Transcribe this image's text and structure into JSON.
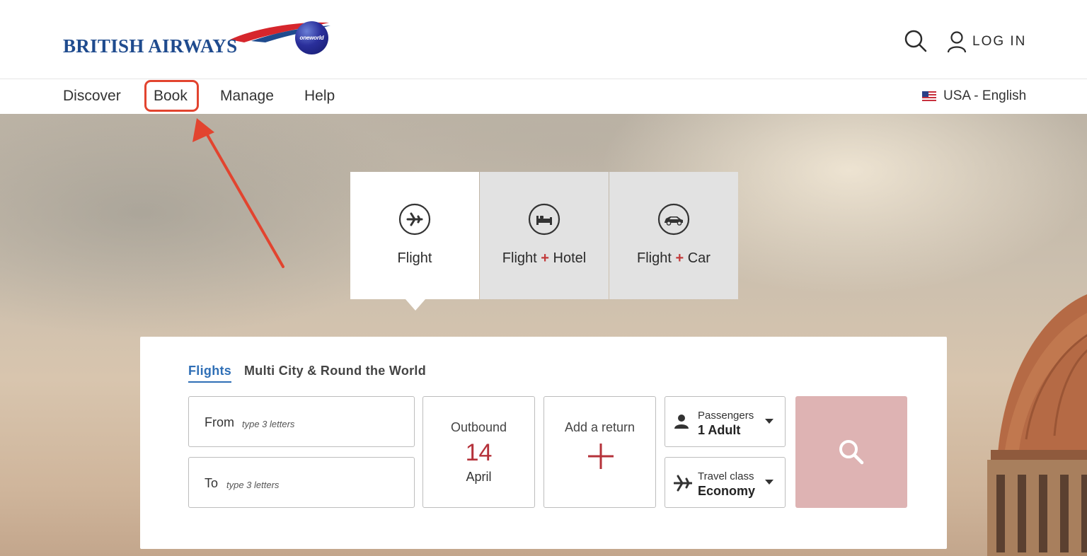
{
  "brand": {
    "name": "BRITISH AIRWAYS",
    "alliance_badge": "oneworld",
    "brand_color": "#1f4b8e",
    "accent_red": "#d6262c"
  },
  "header": {
    "search_icon": "search-icon",
    "login_label": "LOG IN"
  },
  "nav": {
    "items": [
      {
        "label": "Discover"
      },
      {
        "label": "Book"
      },
      {
        "label": "Manage"
      },
      {
        "label": "Help"
      }
    ],
    "locale_label": "USA - English",
    "highlight_color": "#e2442f"
  },
  "product_tabs": [
    {
      "icon": "plane-icon",
      "label": "Flight",
      "active": true
    },
    {
      "icon": "bed-icon",
      "label_a": "Flight",
      "plus": "+",
      "label_b": "Hotel",
      "active": false
    },
    {
      "icon": "car-icon",
      "label_a": "Flight",
      "plus": "+",
      "label_b": "Car",
      "active": false
    }
  ],
  "search_form": {
    "tabs": [
      {
        "label": "Flights",
        "active": true
      },
      {
        "label": "Multi City & Round the World",
        "active": false
      }
    ],
    "from": {
      "label": "From",
      "placeholder": "type 3 letters"
    },
    "to": {
      "label": "To",
      "placeholder": "type 3 letters"
    },
    "outbound": {
      "label": "Outbound",
      "day": "14",
      "month": "April"
    },
    "return": {
      "label": "Add a return"
    },
    "passengers": {
      "label": "Passengers",
      "value": "1 Adult"
    },
    "travel_class": {
      "label": "Travel class",
      "value": "Economy"
    },
    "search_button_color": "#deb3b3"
  }
}
